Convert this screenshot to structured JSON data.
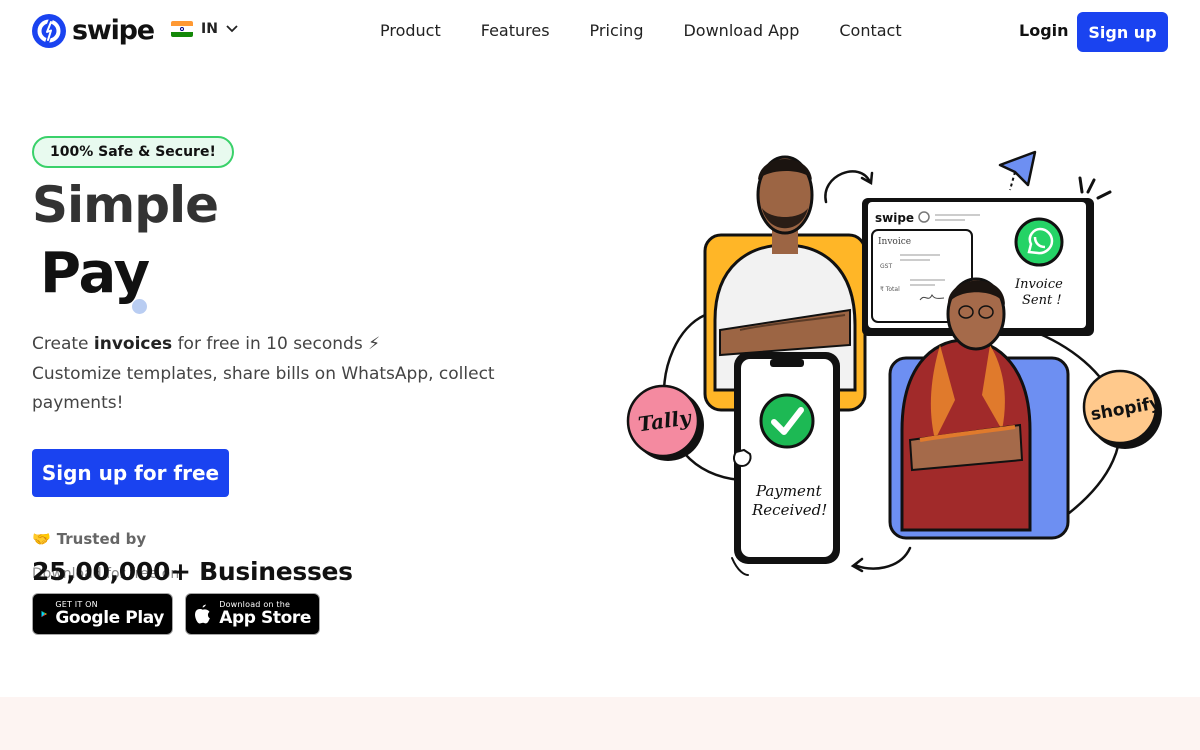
{
  "brand": {
    "name": "swipe"
  },
  "region": {
    "code": "IN",
    "flag": [
      "#ff9933",
      "#ffffff",
      "#138808"
    ]
  },
  "nav": {
    "items": [
      "Product",
      "Features",
      "Pricing",
      "Download App",
      "Contact"
    ]
  },
  "auth": {
    "login": "Login",
    "signup": "Sign up"
  },
  "hero": {
    "badge": "100% Safe & Secure!",
    "title_line1": "Simple",
    "title_line2": "Pay",
    "sub_prefix": "Create",
    "sub_bold": "invoices",
    "sub_suffix": "for free in 10 seconds ⚡",
    "sub_line2": "Customize templates, share bills on WhatsApp, collect payments!",
    "cta": "Sign up for free",
    "trusted_icon": "🤝",
    "trusted": "Trusted by",
    "download_text": "Download for free on",
    "businesses": "25,00,000+ Businesses"
  },
  "stores": {
    "google_small": "GET IT ON",
    "google_big": "Google Play",
    "apple_small": "Download on the",
    "apple_big": "App Store"
  },
  "illustration": {
    "swipe_label": "swipe",
    "invoice_label": "Invoice",
    "gst_label": "GST",
    "total_label": "₹ Total",
    "sent_line1": "Invoice",
    "sent_line2": "Sent !",
    "payment_line1": "Payment",
    "payment_line2": "Received!",
    "tally": "Tally",
    "shopify": "shopify"
  },
  "colors": {
    "accent": "#1a43f0",
    "badge_border": "#3ad16a",
    "band": "#fdf4f2"
  }
}
